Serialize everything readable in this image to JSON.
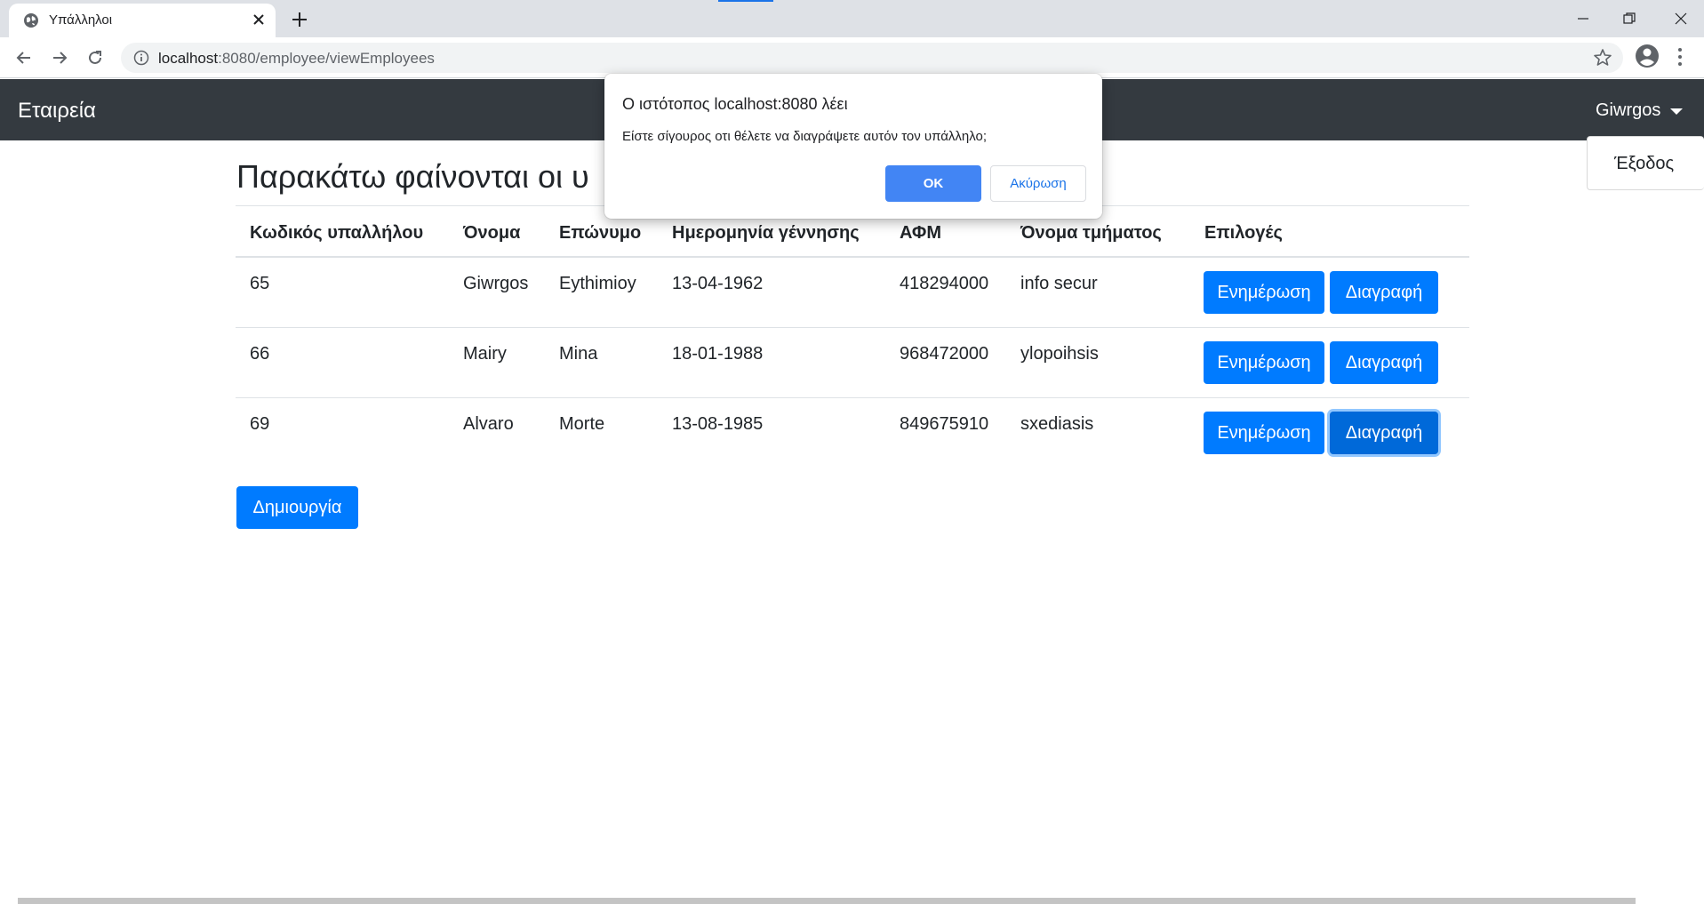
{
  "browser": {
    "tab_title": "Υπάλληλοι",
    "url_host": "localhost",
    "url_rest": ":8080/employee/viewEmployees",
    "icons": {
      "favicon": "globe-icon",
      "close": "close-icon",
      "new_tab": "plus-icon",
      "back": "arrow-left-icon",
      "forward": "arrow-right-icon",
      "reload": "reload-icon",
      "info": "info-icon",
      "bookmark": "star-icon",
      "profile": "account-circle-icon",
      "menu": "kebab-menu-icon"
    }
  },
  "navbar": {
    "brand": "Εταιρεία",
    "user": "Giwrgos",
    "dropdown_logout": "Έξοδος"
  },
  "main": {
    "heading": "Παρακάτω φαίνονται οι υ",
    "table": {
      "headers": [
        "Κωδικός υπαλλήλου",
        "Όνομα",
        "Επώνυμο",
        "Ημερομηνία γέννησης",
        "ΑΦΜ",
        "Όνομα τμήματος",
        "Επιλογές"
      ],
      "rows": [
        [
          "65",
          "Giwrgos",
          "Eythimioy",
          "13-04-1962",
          "418294000",
          "info secur"
        ],
        [
          "66",
          "Mairy",
          "Mina",
          "18-01-1988",
          "968472000",
          "ylopoihsis"
        ],
        [
          "69",
          "Alvaro",
          "Morte",
          "13-08-1985",
          "849675910",
          "sxediasis"
        ]
      ],
      "update_label": "Ενημέρωση",
      "delete_label": "Διαγραφή"
    },
    "create_label": "Δημιουργία"
  },
  "dialog": {
    "title": "Ο ιστότοπος localhost:8080 λέει",
    "message": "Είστε σίγουρος οτι θέλετε να διαγράψετε αυτόν τον υπάλληλο;",
    "ok_label": "OK",
    "cancel_label": "Ακύρωση"
  },
  "colors": {
    "primary": "#007bff",
    "navbar_bg": "#343a40",
    "dialog_ok": "#4285f4"
  }
}
